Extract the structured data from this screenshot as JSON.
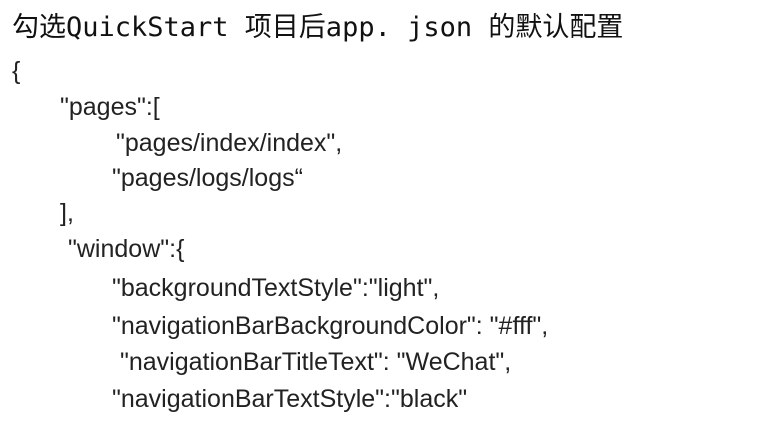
{
  "title": "勾选QuickStart 项目后app. json 的默认配置",
  "code_lines": [
    "{",
    "\"pages\":[",
    "\"pages/index/index\",",
    "\"pages/logs/logs“",
    "],",
    "\"window\":{",
    "\"backgroundTextStyle\":\"light\",",
    "\"navigationBarBackgroundColor\": \"#fff\",",
    "\"navigationBarTitleText\": \"WeChat\",",
    "\"navigationBarTextStyle\":\"black\""
  ]
}
